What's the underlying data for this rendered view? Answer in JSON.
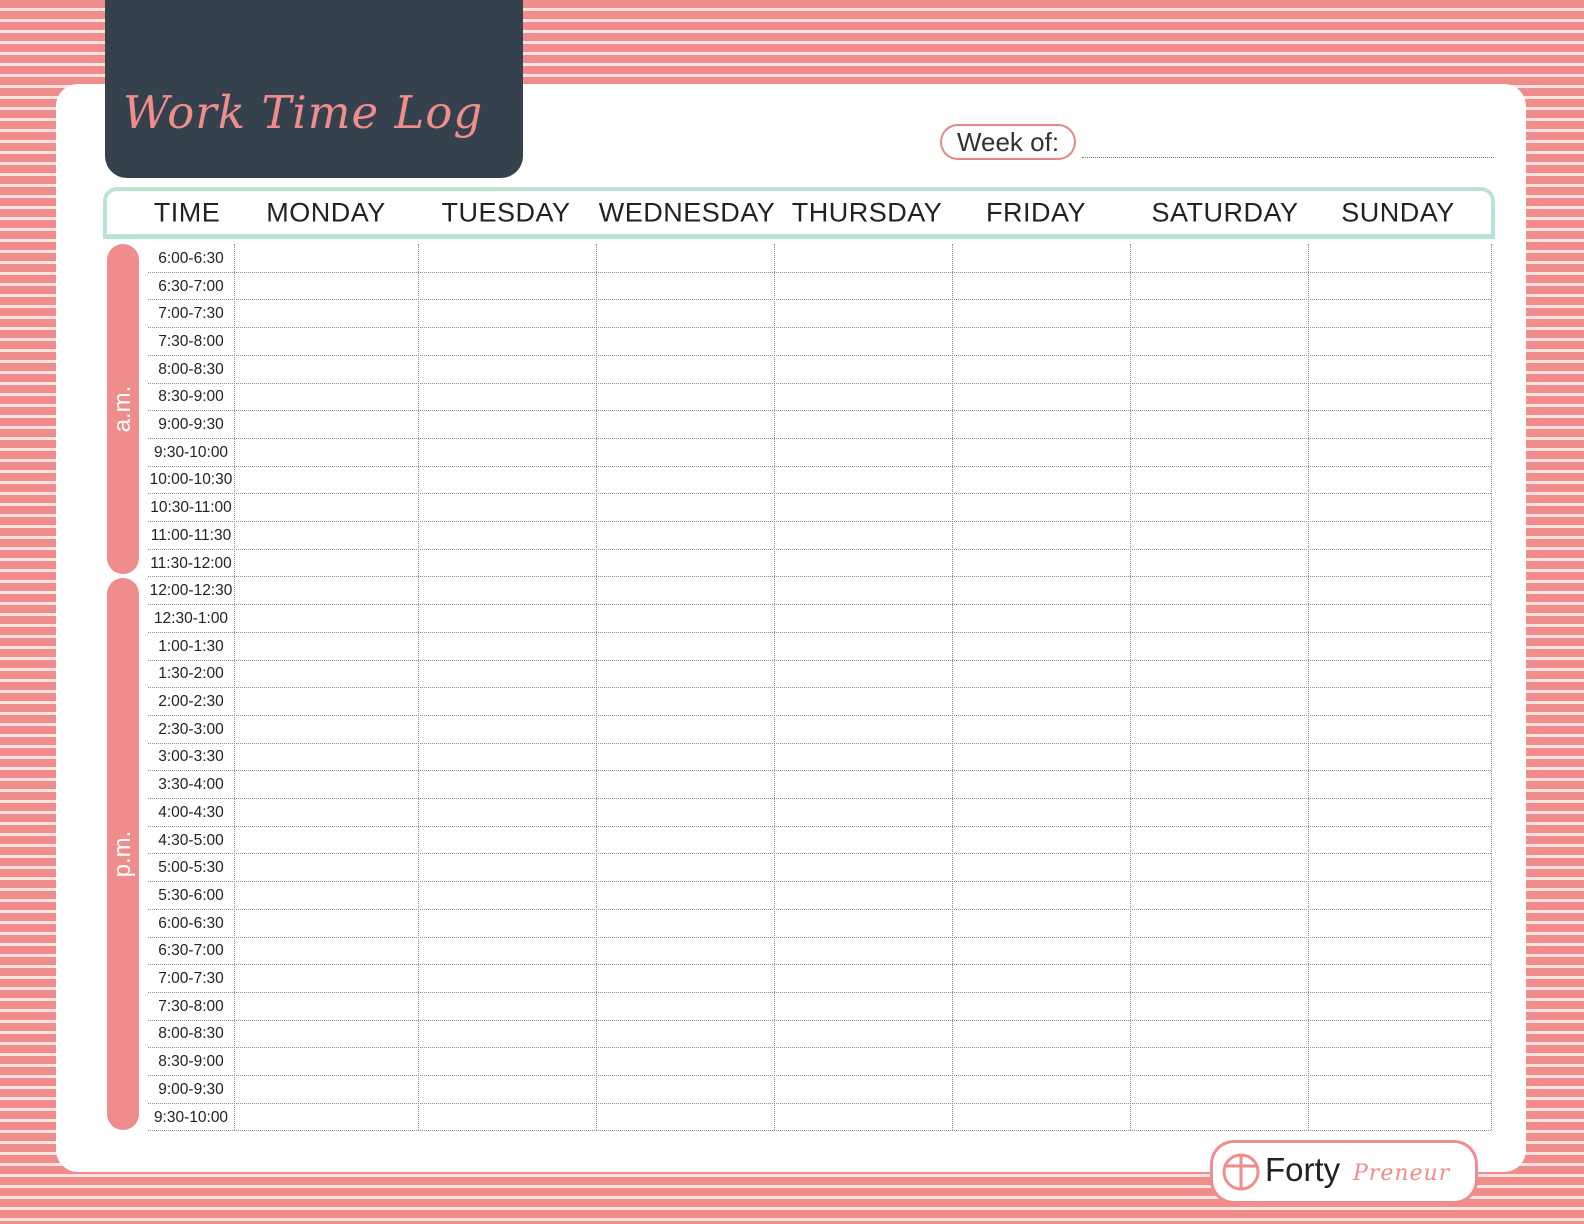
{
  "title": "Work Time Log",
  "week_of_label": "Week of:",
  "header": {
    "time": "TIME",
    "days": [
      "MONDAY",
      "TUESDAY",
      "WEDNESDAY",
      "THURSDAY",
      "FRIDAY",
      "SATURDAY",
      "SUNDAY"
    ]
  },
  "periods": {
    "am": "a.m.",
    "pm": "p.m."
  },
  "time_slots_am": [
    "6:00-6:30",
    "6:30-7:00",
    "7:00-7:30",
    "7:30-8:00",
    "8:00-8:30",
    "8:30-9:00",
    "9:00-9:30",
    "9:30-10:00",
    "10:00-10:30",
    "10:30-11:00",
    "11:00-11:30",
    "11:30-12:00"
  ],
  "time_slots_pm": [
    "12:00-12:30",
    "12:30-1:00",
    "1:00-1:30",
    "1:30-2:00",
    "2:00-2:30",
    "2:30-3:00",
    "3:00-3:30",
    "3:30-4:00",
    "4:00-4:30",
    "4:30-5:00",
    "5:00-5:30",
    "5:30-6:00",
    "6:00-6:30",
    "6:30-7:00",
    "7:00-7:30",
    "7:30-8:00",
    "8:00-8:30",
    "8:30-9:00",
    "9:00-9:30",
    "9:30-10:00"
  ],
  "logo": {
    "forty": "Forty",
    "preneur": "Preneur"
  },
  "colors": {
    "accent_pink": "#ee8d8c",
    "title_box": "#36414e",
    "header_mint": "#b9e4d4"
  }
}
